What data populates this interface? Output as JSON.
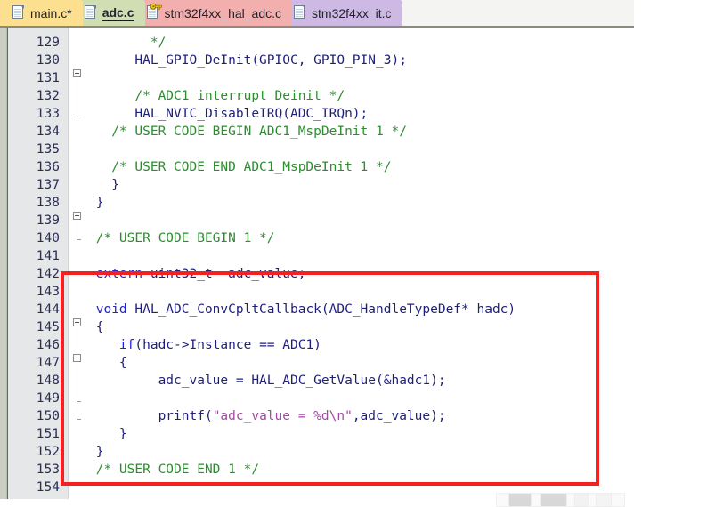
{
  "window": {
    "app": "code-editor",
    "accent_red": "#f42121"
  },
  "tabbar": {
    "tabs": [
      {
        "label": "main.c*",
        "icon": "document-icon",
        "color": "#fcdf8f",
        "active": false,
        "readonly": false
      },
      {
        "label": "adc.c",
        "icon": "document-icon",
        "color": "#cfdfb3",
        "active": true,
        "readonly": false
      },
      {
        "label": "stm32f4xx_hal_adc.c",
        "icon": "document-key-icon",
        "color": "#f3aeae",
        "active": false,
        "readonly": true
      },
      {
        "label": "stm32f4xx_it.c",
        "icon": "document-icon",
        "color": "#cdb9e4",
        "active": false,
        "readonly": false
      }
    ]
  },
  "editor": {
    "first_line": 129,
    "lines": [
      {
        "n": 129,
        "segs": [
          {
            "t": "        */",
            "c": "cm"
          }
        ]
      },
      {
        "n": 130,
        "segs": [
          {
            "t": "      HAL_GPIO_DeInit(GPIOC, GPIO_PIN_3);",
            "c": "code"
          }
        ]
      },
      {
        "n": 131,
        "segs": [
          {
            "t": "",
            "c": "code"
          }
        ]
      },
      {
        "n": 132,
        "segs": [
          {
            "t": "      /* ADC1 interrupt Deinit */",
            "c": "cm"
          }
        ]
      },
      {
        "n": 133,
        "segs": [
          {
            "t": "      HAL_NVIC_DisableIRQ(ADC_IRQn);",
            "c": "code"
          }
        ]
      },
      {
        "n": 134,
        "segs": [
          {
            "t": "   /* USER CODE BEGIN ADC1_MspDeInit 1 */",
            "c": "cm"
          }
        ]
      },
      {
        "n": 135,
        "segs": [
          {
            "t": "",
            "c": "code"
          }
        ]
      },
      {
        "n": 136,
        "segs": [
          {
            "t": "   /* USER CODE END ADC1_MspDeInit 1 */",
            "c": "cm"
          }
        ]
      },
      {
        "n": 137,
        "segs": [
          {
            "t": "   }",
            "c": "code"
          }
        ]
      },
      {
        "n": 138,
        "segs": [
          {
            "t": " }",
            "c": "code"
          }
        ]
      },
      {
        "n": 139,
        "segs": [
          {
            "t": "",
            "c": "code"
          }
        ]
      },
      {
        "n": 140,
        "segs": [
          {
            "t": " /* USER CODE BEGIN 1 */",
            "c": "cm"
          }
        ]
      },
      {
        "n": 141,
        "segs": [
          {
            "t": "",
            "c": "code"
          }
        ]
      },
      {
        "n": 142,
        "segs": [
          {
            "t": " extern",
            "c": "kw"
          },
          {
            "t": " uint32_t  adc_value;",
            "c": "code"
          }
        ]
      },
      {
        "n": 143,
        "segs": [
          {
            "t": "",
            "c": "code"
          }
        ]
      },
      {
        "n": 144,
        "segs": [
          {
            "t": " void",
            "c": "kw"
          },
          {
            "t": " HAL_ADC_ConvCpltCallback(ADC_HandleTypeDef* hadc)",
            "c": "code"
          }
        ]
      },
      {
        "n": 145,
        "segs": [
          {
            "t": " {",
            "c": "code"
          }
        ]
      },
      {
        "n": 146,
        "segs": [
          {
            "t": "    ",
            "c": "code"
          },
          {
            "t": "if",
            "c": "kw"
          },
          {
            "t": "(hadc->Instance == ADC1)",
            "c": "code"
          }
        ]
      },
      {
        "n": 147,
        "segs": [
          {
            "t": "    {",
            "c": "code"
          }
        ]
      },
      {
        "n": 148,
        "segs": [
          {
            "t": "         adc_value = HAL_ADC_GetValue(&hadc1);",
            "c": "code"
          }
        ]
      },
      {
        "n": 149,
        "segs": [
          {
            "t": "",
            "c": "code"
          }
        ]
      },
      {
        "n": 150,
        "segs": [
          {
            "t": "         printf(",
            "c": "code"
          },
          {
            "t": "\"adc_value = %d\\n\"",
            "c": "str"
          },
          {
            "t": ",adc_value);",
            "c": "code"
          }
        ]
      },
      {
        "n": 151,
        "segs": [
          {
            "t": "    }",
            "c": "code"
          }
        ]
      },
      {
        "n": 152,
        "segs": [
          {
            "t": " }",
            "c": "code"
          }
        ]
      },
      {
        "n": 153,
        "segs": [
          {
            "t": " /* USER CODE END 1 */",
            "c": "cm"
          }
        ]
      },
      {
        "n": 154,
        "segs": [
          {
            "t": "",
            "c": "code"
          }
        ]
      }
    ]
  },
  "annotation": {
    "shape": "rectangle",
    "color": "#f42121",
    "covers_lines": "142-154"
  },
  "scrollbar": {
    "orientation": "horizontal",
    "visible": true
  }
}
